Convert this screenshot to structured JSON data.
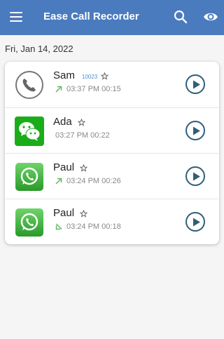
{
  "app": {
    "title": "Ease Call Recorder"
  },
  "colors": {
    "primary": "#4a7bbf",
    "outgoing": "#5cb85c",
    "incoming": "#5cb85c",
    "play": "#2f5e7a"
  },
  "date_header": "Fri, Jan 14, 2022",
  "calls": [
    {
      "name": "Sam",
      "number": "10023",
      "source": "phone-icon",
      "direction": "outgoing",
      "time": "03:37 PM",
      "duration": "00:15"
    },
    {
      "name": "Ada",
      "number": "",
      "source": "wechat-icon",
      "direction": "none",
      "time": "03:27 PM",
      "duration": "00:22"
    },
    {
      "name": "Paul",
      "number": "",
      "source": "whatsapp-icon",
      "direction": "outgoing",
      "time": "03:24 PM",
      "duration": "00:26"
    },
    {
      "name": "Paul",
      "number": "",
      "source": "whatsapp-icon",
      "direction": "incoming",
      "time": "03:24 PM",
      "duration": "00:18"
    }
  ]
}
